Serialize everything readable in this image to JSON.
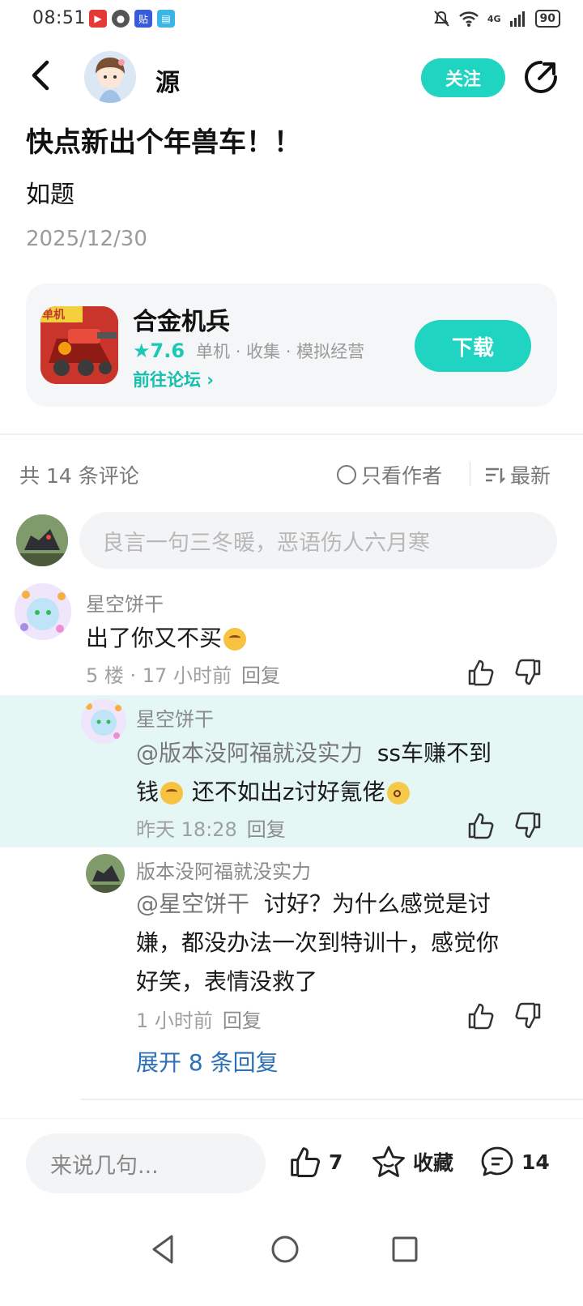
{
  "status_bar": {
    "time": "08:51",
    "network": "4G",
    "battery": "90"
  },
  "header": {
    "author_name": "源",
    "follow_label": "关注"
  },
  "post": {
    "title": "快点新出个年兽车！！",
    "body": "如题",
    "date": "2025/12/30"
  },
  "game_card": {
    "icon_badge": "单机",
    "name": "合金机兵",
    "rating": "★7.6",
    "tags": "单机 · 收集 · 模拟经营",
    "forum_link": "前往论坛 ›",
    "download_label": "下载"
  },
  "comments_bar": {
    "count_label": "共 14 条评论",
    "only_author_label": "只看作者",
    "sort_label": "最新",
    "input_placeholder": "良言一句三冬暖，恶语伤人六月寒"
  },
  "comments": [
    {
      "name": "星空饼干",
      "text": "出了你又不买",
      "meta": "5 楼 · 17 小时前",
      "reply_label": "回复"
    },
    {
      "name": "星空饼干",
      "mention": "@版本没阿福就没实力",
      "text_1": "ss车赚不到",
      "text_2": "钱",
      "text_3": "还不如出z讨好氪佬",
      "meta": "昨天 18:28",
      "reply_label": "回复"
    },
    {
      "name": "版本没阿福就没实力",
      "mention": "@星空饼干",
      "text_1": "讨好？为什么感觉是讨",
      "text_2": "嫌，都没办法一次到特训十，感觉你",
      "text_3": "好笑，表情没救了",
      "meta": "1 小时前",
      "reply_label": "回复"
    }
  ],
  "expand_label": "展开 8 条回复",
  "bottom_bar": {
    "input_placeholder": "来说几句...",
    "like_count": "7",
    "favorite_label": "收藏",
    "comment_count": "14"
  },
  "colors": {
    "accent": "#1fd4c0",
    "link": "#2b6fb8",
    "highlight_bg": "#e4f7f5"
  }
}
